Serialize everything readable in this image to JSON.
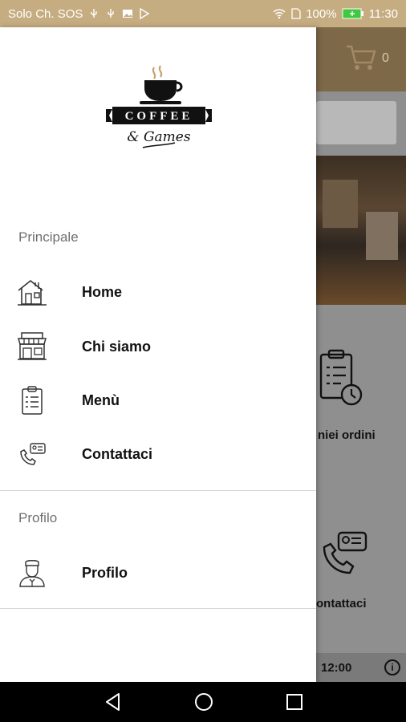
{
  "status_bar": {
    "carrier": "Solo Ch. SOS",
    "battery": "100%",
    "time": "11:30"
  },
  "background_app": {
    "cart_count": "0",
    "orders_label": "niei ordini",
    "contact_label": "ontattaci",
    "hours_text": "12:00"
  },
  "drawer": {
    "logo_text_top": "COFFEE",
    "logo_text_bottom": "& Games",
    "sections": [
      {
        "title": "Principale",
        "items": [
          {
            "label": "Home",
            "icon": "house-icon"
          },
          {
            "label": "Chi siamo",
            "icon": "shop-icon"
          },
          {
            "label": "Menù",
            "icon": "clipboard-icon"
          },
          {
            "label": "Contattaci",
            "icon": "phone-contact-icon"
          }
        ]
      },
      {
        "title": "Profilo",
        "items": [
          {
            "label": "Profilo",
            "icon": "waiter-icon"
          }
        ]
      }
    ]
  },
  "nav_bar": {
    "back": "back-icon",
    "home": "home-circle-icon",
    "recents": "recents-icon"
  },
  "colors": {
    "status_bar": "#c6ac81",
    "accent_text": "#111111",
    "section_title": "#6f6f6f"
  }
}
